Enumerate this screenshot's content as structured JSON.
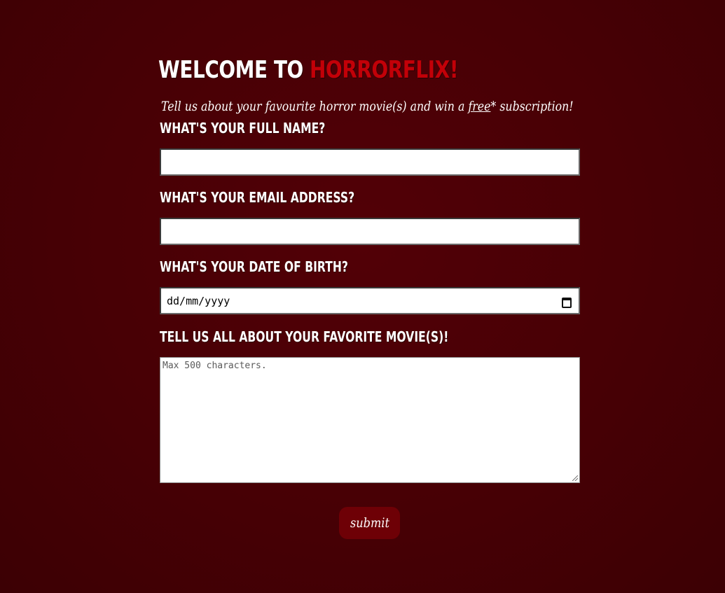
{
  "header": {
    "title_prefix": "Welcome to ",
    "title_brand": "Horrorflix!",
    "intro_before": "Tell us about your favourite horror movie(s) and win a ",
    "intro_free": "free",
    "intro_after": "* subscription!"
  },
  "form": {
    "name_label": "What's your full name?",
    "name_value": "",
    "email_label": "What's your email address?",
    "email_value": "",
    "dob_label": "What's your date of birth?",
    "dob_placeholder": "dd/mm/yyyy",
    "movies_label": "Tell us all about your favorite movie(s)!",
    "movies_placeholder": "Max 500 characters.",
    "submit_label": "submit"
  },
  "icons": {
    "calendar": "calendar-icon"
  },
  "colors": {
    "background": "#4a0005",
    "brand_red": "#c20008",
    "button": "#6e0006",
    "text": "#ffffff"
  }
}
